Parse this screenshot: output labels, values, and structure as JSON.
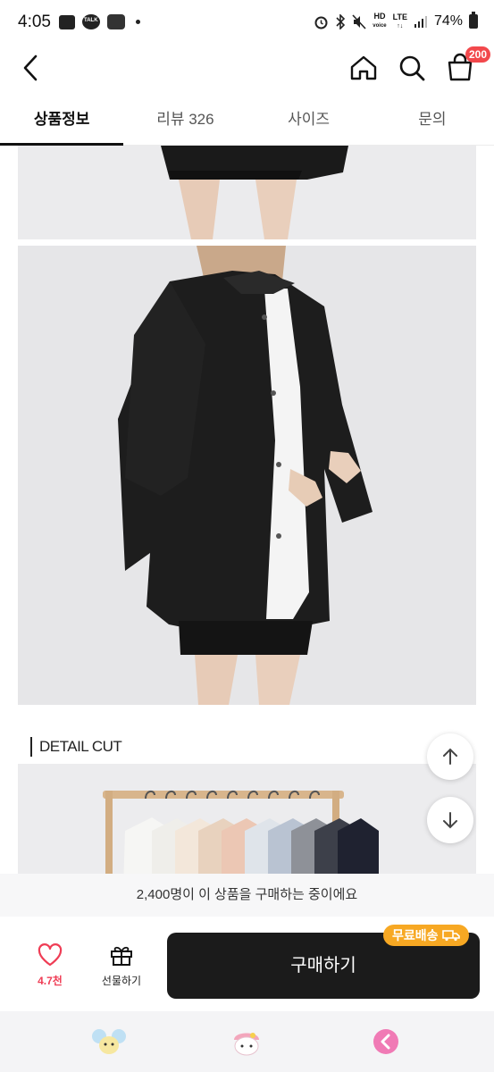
{
  "status_bar": {
    "time": "4:05",
    "talk_label": "TALK",
    "hd_label": "HD",
    "voice_label": "voice",
    "lte_label": "LTE",
    "battery": "74%"
  },
  "header": {
    "cart_badge": "200"
  },
  "tabs": [
    {
      "label": "상품정보"
    },
    {
      "label": "리뷰 326"
    },
    {
      "label": "사이즈"
    },
    {
      "label": "문의"
    }
  ],
  "content": {
    "detail_heading": "DETAIL CUT"
  },
  "buyer_strip": {
    "text": "2,400명이 이 상품을 구매하는 중이에요"
  },
  "action_bar": {
    "like_count": "4.7천",
    "gift_label": "선물하기",
    "buy_label": "구매하기",
    "free_shipping": "무료배송"
  },
  "colors": {
    "accent_red": "#ef3d55",
    "badge_red": "#f2484c",
    "buy_button": "#1b1b1b",
    "free_ship_orange": "#f7a823"
  }
}
